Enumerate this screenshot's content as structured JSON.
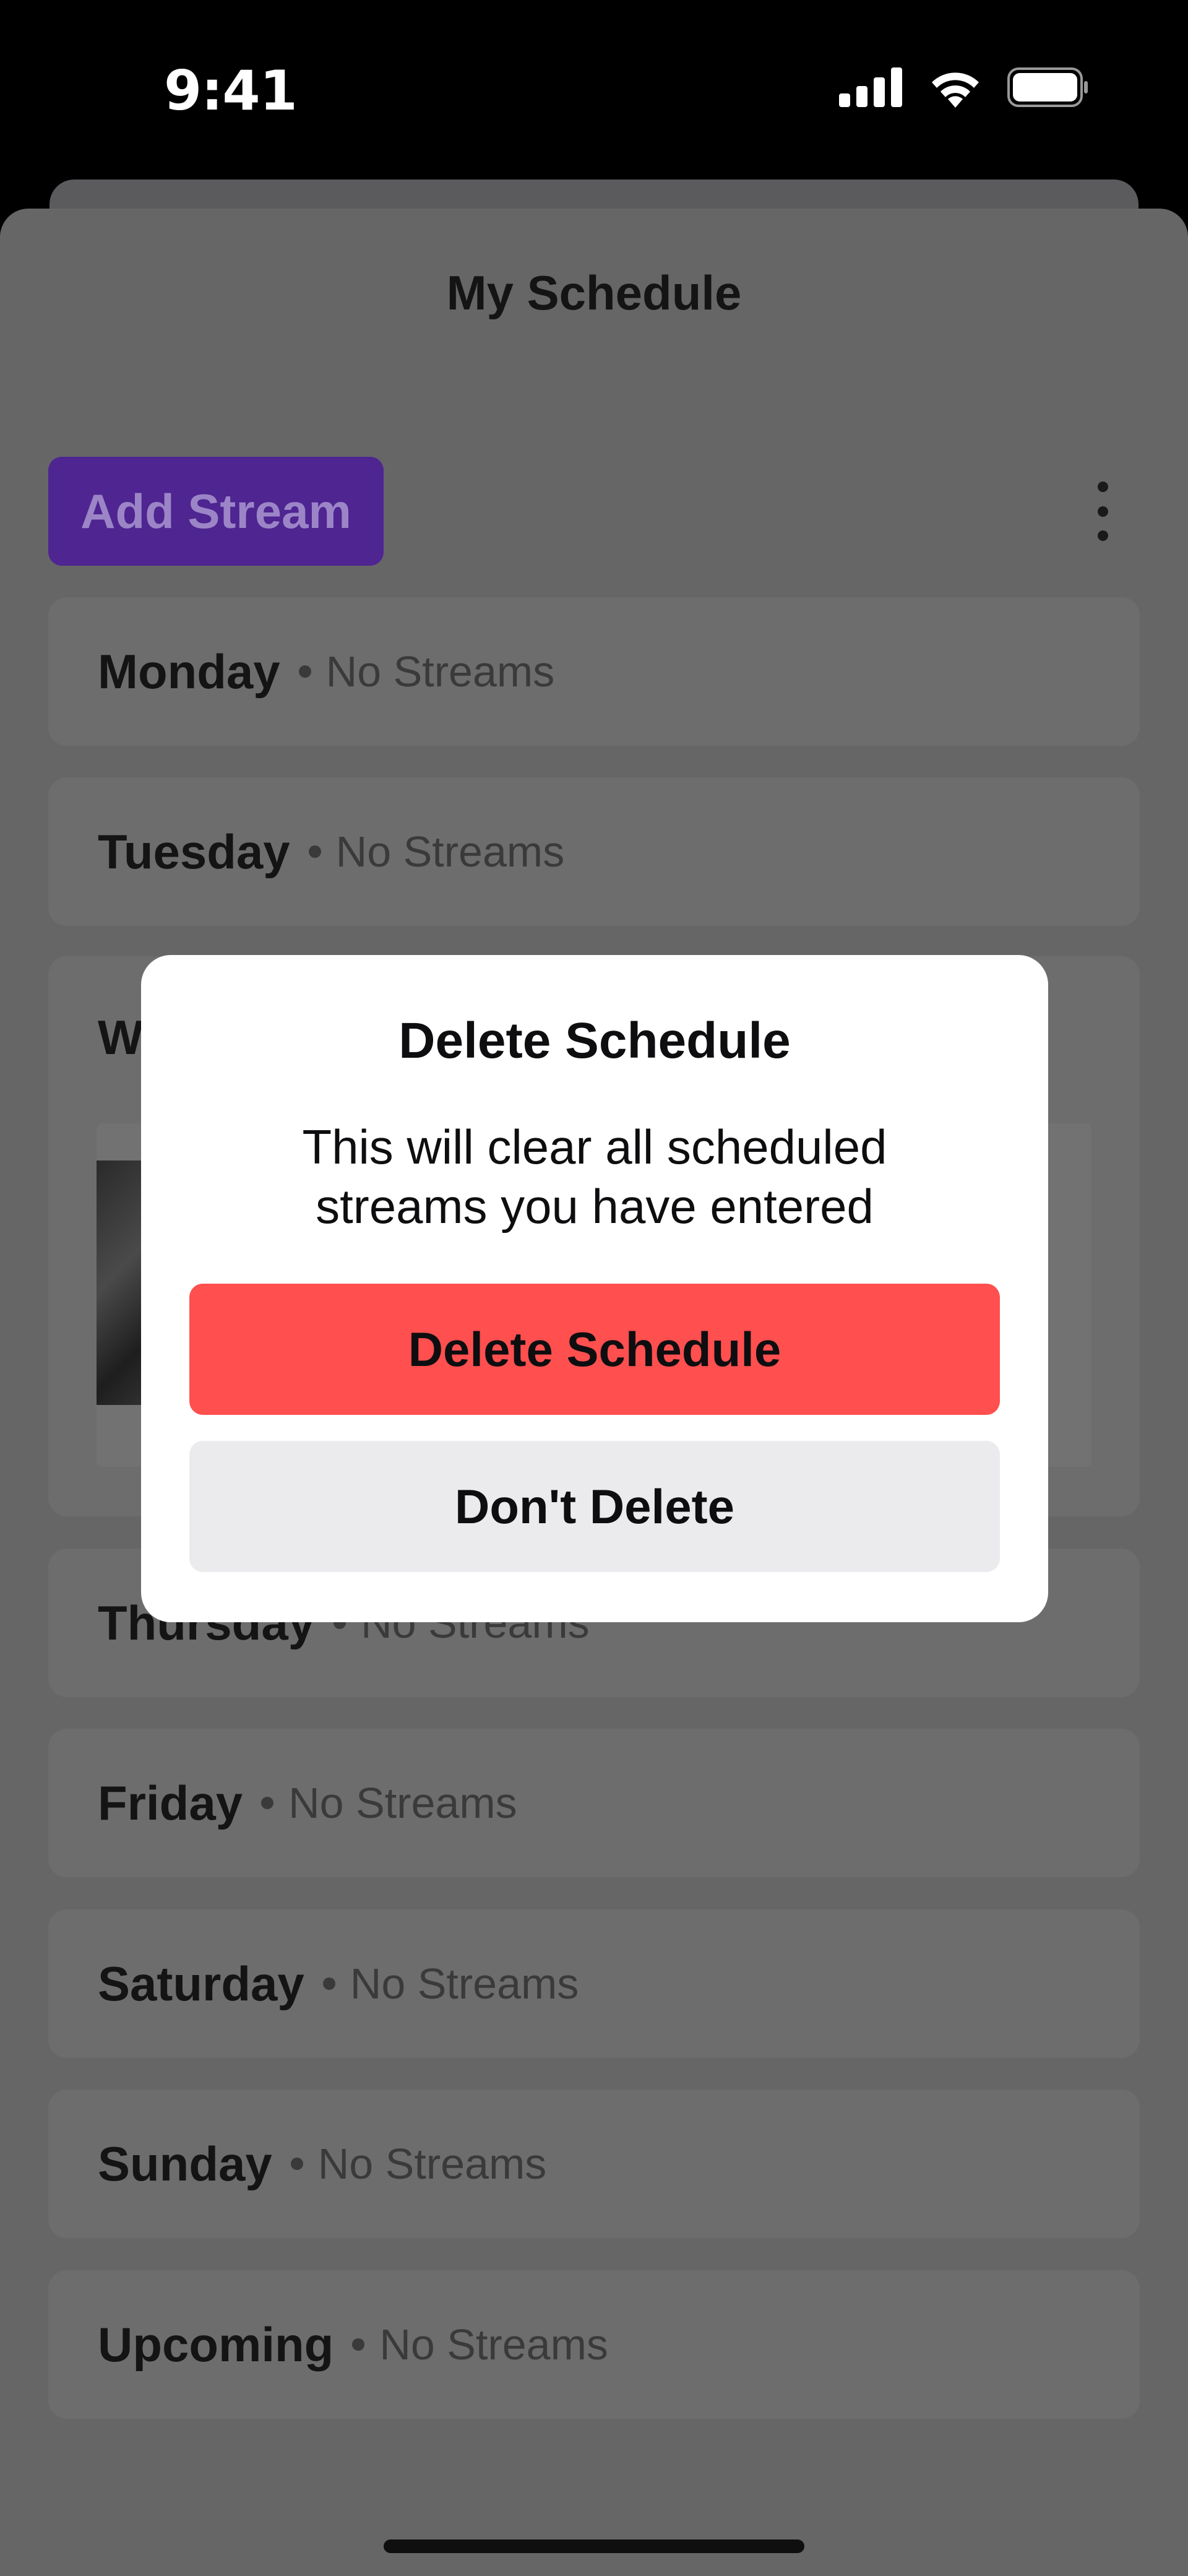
{
  "status_bar": {
    "time": "9:41"
  },
  "sheet": {
    "title": "My Schedule",
    "add_stream_label": "Add Stream"
  },
  "days": [
    {
      "name": "Monday",
      "status": "No Streams"
    },
    {
      "name": "Tuesday",
      "status": "No Streams"
    },
    {
      "name": "Thursday",
      "status": "No Streams"
    },
    {
      "name": "Friday",
      "status": "No Streams"
    },
    {
      "name": "Saturday",
      "status": "No Streams"
    },
    {
      "name": "Sunday",
      "status": "No Streams"
    },
    {
      "name": "Upcoming",
      "status": "No Streams"
    }
  ],
  "wednesday": {
    "partial_label": "W"
  },
  "modal": {
    "title": "Delete Schedule",
    "message": "This will clear all scheduled streams you have entered",
    "confirm_label": "Delete Schedule",
    "cancel_label": "Don't Delete"
  },
  "colors": {
    "accent_purple": "#772ce8",
    "danger_red": "#ff4f4f",
    "neutral_button": "#ebebed"
  }
}
